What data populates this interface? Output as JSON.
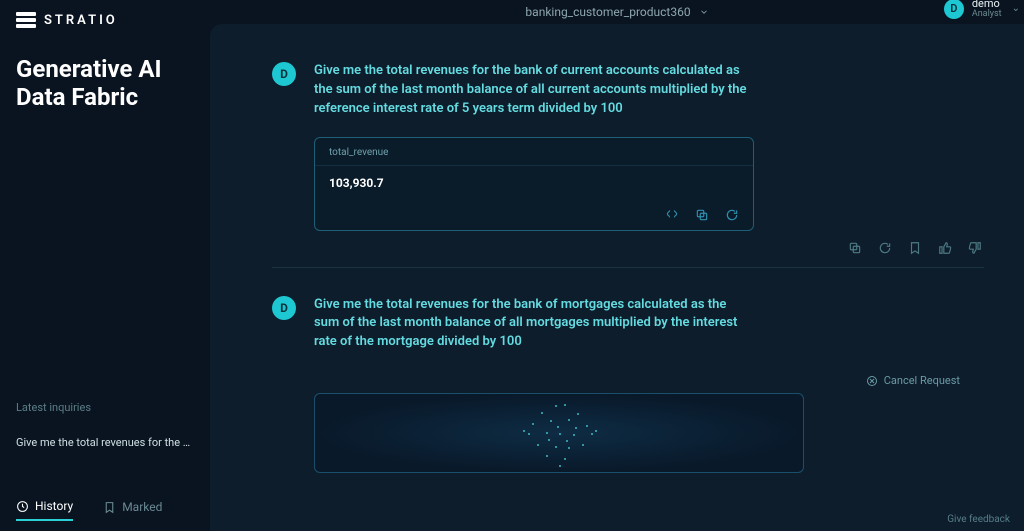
{
  "brand": "STRATIO",
  "sidebar": {
    "title_line1": "Generative AI",
    "title_line2": "Data Fabric",
    "latest_label": "Latest inquiries",
    "inquiry_preview": "Give me the total revenues for the b...",
    "tabs": {
      "history": "History",
      "marked": "Marked"
    }
  },
  "header": {
    "project": "banking_customer_product360",
    "user": {
      "initial": "D",
      "name": "demo",
      "role": "Analyst"
    }
  },
  "conversation": {
    "avatar_letter": "D",
    "msg1": "Give me the total revenues for the bank of current accounts calculated as the sum of the last month balance of all current accounts multiplied by the reference interest rate of 5 years term divided by 100",
    "result1": {
      "column": "total_revenue",
      "value": "103,930.7"
    },
    "msg2": "Give me the total revenues for the bank of mortgages calculated as the sum of the last month balance of all mortgages multiplied by the interest rate of the mortgage divided by 100",
    "cancel_label": "Cancel Request"
  },
  "footer": {
    "feedback": "Give feedback"
  }
}
